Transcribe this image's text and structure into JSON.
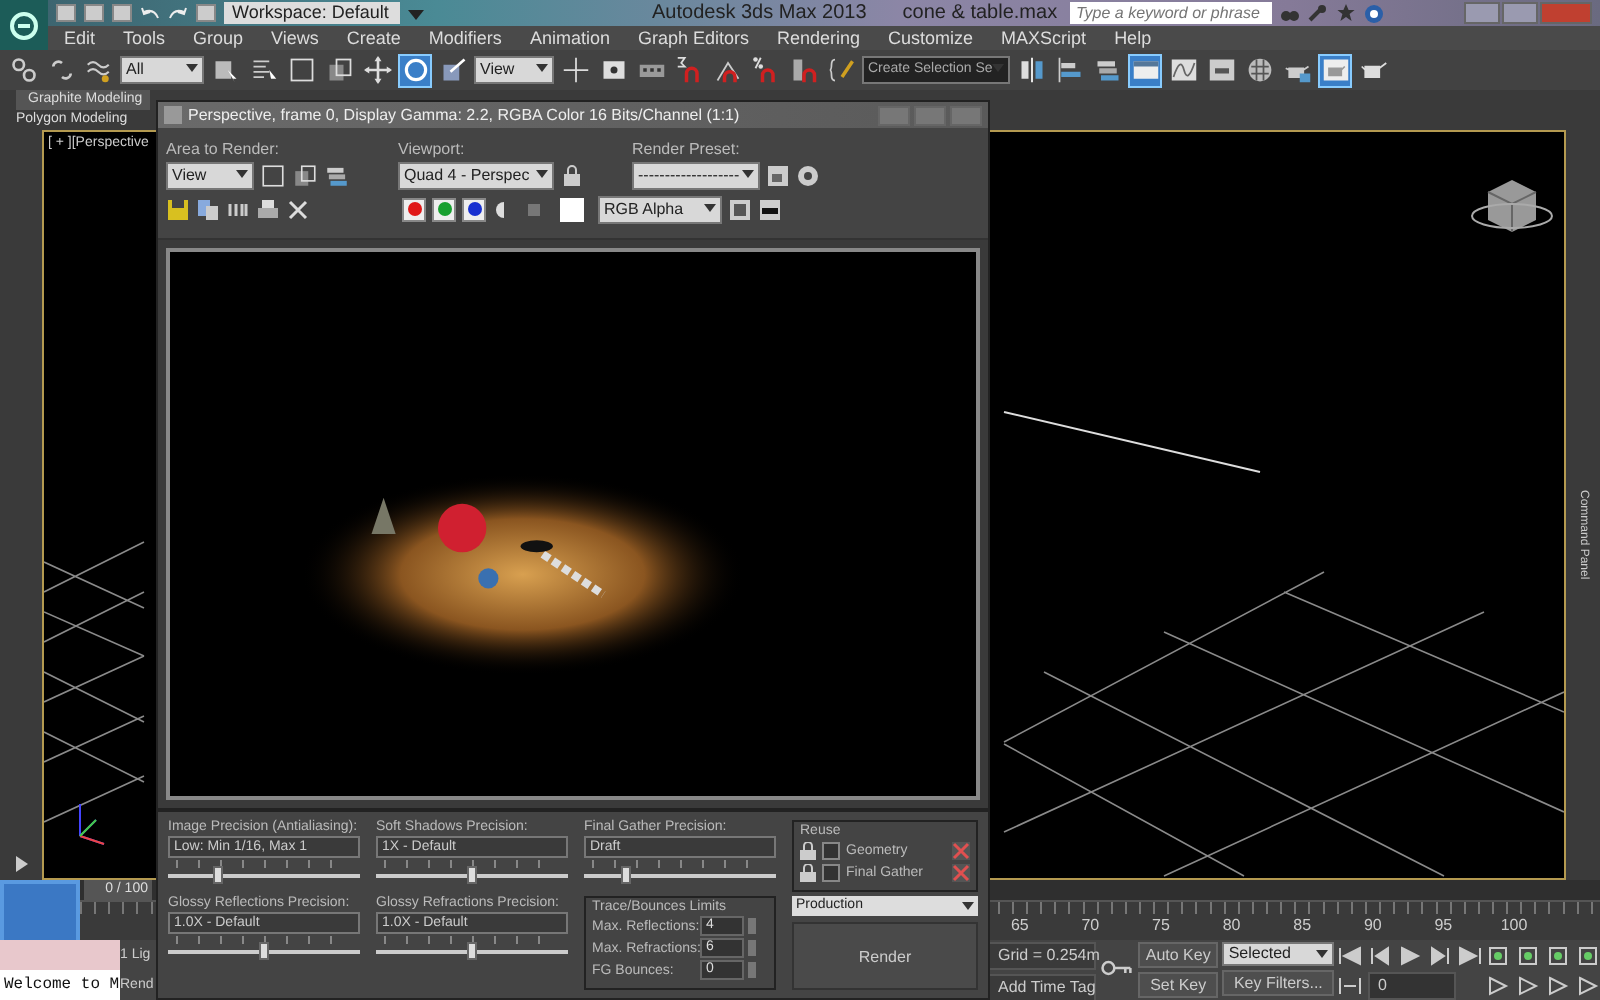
{
  "title_bar": {
    "workspace": "Workspace: Default",
    "app_title": "Autodesk 3ds Max 2013",
    "file_name": "cone & table.max",
    "search": {
      "placeholder": "Type a keyword or phrase"
    }
  },
  "menu": [
    "Edit",
    "Tools",
    "Group",
    "Views",
    "Create",
    "Modifiers",
    "Animation",
    "Graph Editors",
    "Rendering",
    "Customize",
    "MAXScript",
    "Help"
  ],
  "main_toolbar": {
    "selection_filter": "All",
    "reference_coord": "View",
    "named_selection": "Create Selection Se",
    "tools": [
      {
        "kind": "link",
        "selected": false
      },
      {
        "kind": "unlink",
        "selected": false
      },
      {
        "kind": "bind",
        "selected": false
      },
      {
        "kind": "filter"
      },
      {
        "kind": "select",
        "selected": false
      },
      {
        "kind": "selectname",
        "selected": false
      },
      {
        "kind": "region",
        "selected": false
      },
      {
        "kind": "crossing",
        "selected": false
      },
      {
        "kind": "move",
        "selected": false
      },
      {
        "kind": "rotate",
        "selected": true
      },
      {
        "kind": "scale",
        "selected": false
      },
      {
        "kind": "coord"
      },
      {
        "kind": "pivot",
        "selected": false
      },
      {
        "kind": "manipulate",
        "selected": false
      },
      {
        "kind": "keyboard",
        "selected": false
      },
      {
        "kind": "snap",
        "selected": false
      },
      {
        "kind": "anglesnap",
        "selected": false
      },
      {
        "kind": "percentsnap",
        "selected": false
      },
      {
        "kind": "spinnersnap",
        "selected": false
      },
      {
        "kind": "namededit",
        "selected": false
      },
      {
        "kind": "named"
      },
      {
        "kind": "mirror",
        "selected": false
      },
      {
        "kind": "align",
        "selected": false
      },
      {
        "kind": "layers",
        "selected": false
      },
      {
        "kind": "ribbon",
        "selected": true
      },
      {
        "kind": "curve",
        "selected": false
      },
      {
        "kind": "schematic",
        "selected": false
      },
      {
        "kind": "material",
        "selected": false
      },
      {
        "kind": "rendersetup",
        "selected": false
      },
      {
        "kind": "framewindow",
        "selected": true
      },
      {
        "kind": "render",
        "selected": false
      }
    ]
  },
  "ribbon": {
    "tab": "Graphite Modeling",
    "panel": "Polygon Modeling"
  },
  "viewport": {
    "label": "[ + ][Perspective"
  },
  "command_panel": "Command Panel",
  "render_window": {
    "title": "Perspective, frame 0, Display Gamma: 2.2, RGBA Color 16 Bits/Channel (1:1)",
    "area_label": "Area to Render:",
    "area_value": "View",
    "viewport_label": "Viewport:",
    "viewport_value": "Quad 4 - Perspec",
    "preset_label": "Render Preset:",
    "preset_value": "-------------------",
    "channels": [
      {
        "color": "#e01818",
        "selected": true
      },
      {
        "color": "#18a030",
        "selected": true
      },
      {
        "color": "#1830d0",
        "selected": true
      }
    ],
    "display_channel": "RGB Alpha",
    "sliders": [
      {
        "label": "Image Precision (Antialiasing):",
        "value": "Low: Min 1/16, Max 1",
        "level": 0.26
      },
      {
        "label": "Soft Shadows Precision:",
        "value": "1X - Default",
        "level": 0.5
      },
      {
        "label": "Final Gather Precision:",
        "value": "Draft",
        "level": 0.22
      },
      {
        "label": "Glossy Reflections Precision:",
        "value": "1.0X - Default",
        "level": 0.5
      },
      {
        "label": "Glossy Refractions Precision:",
        "value": "1.0X - Default",
        "level": 0.5
      }
    ],
    "reuse": {
      "title": "Reuse",
      "options": [
        {
          "label": "Geometry",
          "checked": false
        },
        {
          "label": "Final Gather",
          "checked": false
        }
      ]
    },
    "trace": {
      "title": "Trace/Bounces Limits",
      "fields": [
        {
          "label": "Max. Reflections:",
          "value": "4"
        },
        {
          "label": "Max. Refractions:",
          "value": "6"
        },
        {
          "label": "FG Bounces:",
          "value": "0"
        }
      ]
    },
    "mode": "Production",
    "render_button": "Render"
  },
  "time_slider": {
    "position": "0 / 100"
  },
  "ruler": {
    "labels": [
      "65",
      "70",
      "75",
      "80",
      "85",
      "90",
      "95",
      "100"
    ]
  },
  "status": {
    "listener": "Welcome to M",
    "selection_info": "1 Lig",
    "render_info": "Rend",
    "grid": "Grid = 0.254m",
    "time_tag": "Add Time Tag",
    "auto_key": "Auto Key",
    "key_mode": "Selected",
    "set_key": "Set Key",
    "key_filters": "Key Filters...",
    "frame": "0"
  }
}
